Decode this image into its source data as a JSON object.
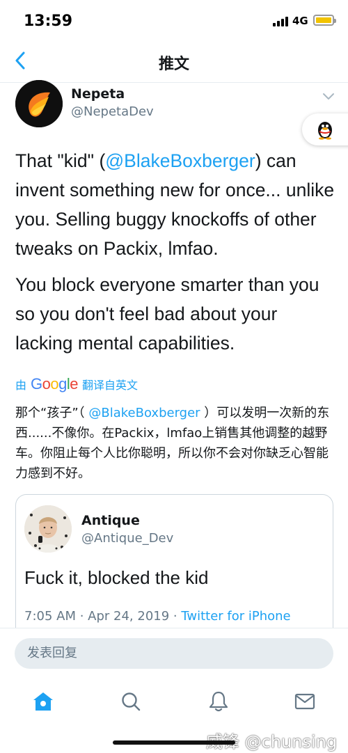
{
  "status_bar": {
    "time": "13:59",
    "network": "4G",
    "battery_level": 0.85,
    "battery_color": "#f2c300"
  },
  "header": {
    "title": "推文",
    "back_icon": "chevron-left-icon"
  },
  "tweet": {
    "author_name": "Nepeta",
    "author_handle": "@NepetaDev",
    "paragraph1": {
      "before": "That \"kid\" (",
      "mention": "@BlakeBoxberger",
      "after": ") can invent something new for once... unlike you. Selling buggy knockoffs of other tweaks on Packix, lmfao."
    },
    "paragraph2": "You block everyone smarter than you so you don't feel bad about your lacking mental capabilities."
  },
  "translation": {
    "prefix": "由",
    "provider": "Google",
    "suffix": "翻译自英文",
    "text_before": "那个“孩子”（ ",
    "mention": "@BlakeBoxberger",
    "text_after": " ）可以发明一次新的东西......不像你。在Packix，lmfao上销售其他调整的越野车。你阻止每个人比你聪明，所以你不会对你缺乏心智能力感到不好。"
  },
  "quoted_tweet": {
    "author_name": "Antique",
    "author_handle": "@Antique_Dev",
    "text": "Fuck it, blocked the kid",
    "time": "7:05 AM · Apr 24, 2019 · ",
    "source": "Twitter for iPhone"
  },
  "reply": {
    "placeholder": "发表回复"
  },
  "tabs": [
    {
      "icon": "home-icon",
      "active": true
    },
    {
      "icon": "search-icon",
      "active": false
    },
    {
      "icon": "bell-icon",
      "active": false
    },
    {
      "icon": "mail-icon",
      "active": false
    }
  ],
  "watermark": "威锋 @chunsing",
  "colors": {
    "accent": "#1da1f2",
    "text": "#14171a",
    "secondary": "#657786"
  }
}
